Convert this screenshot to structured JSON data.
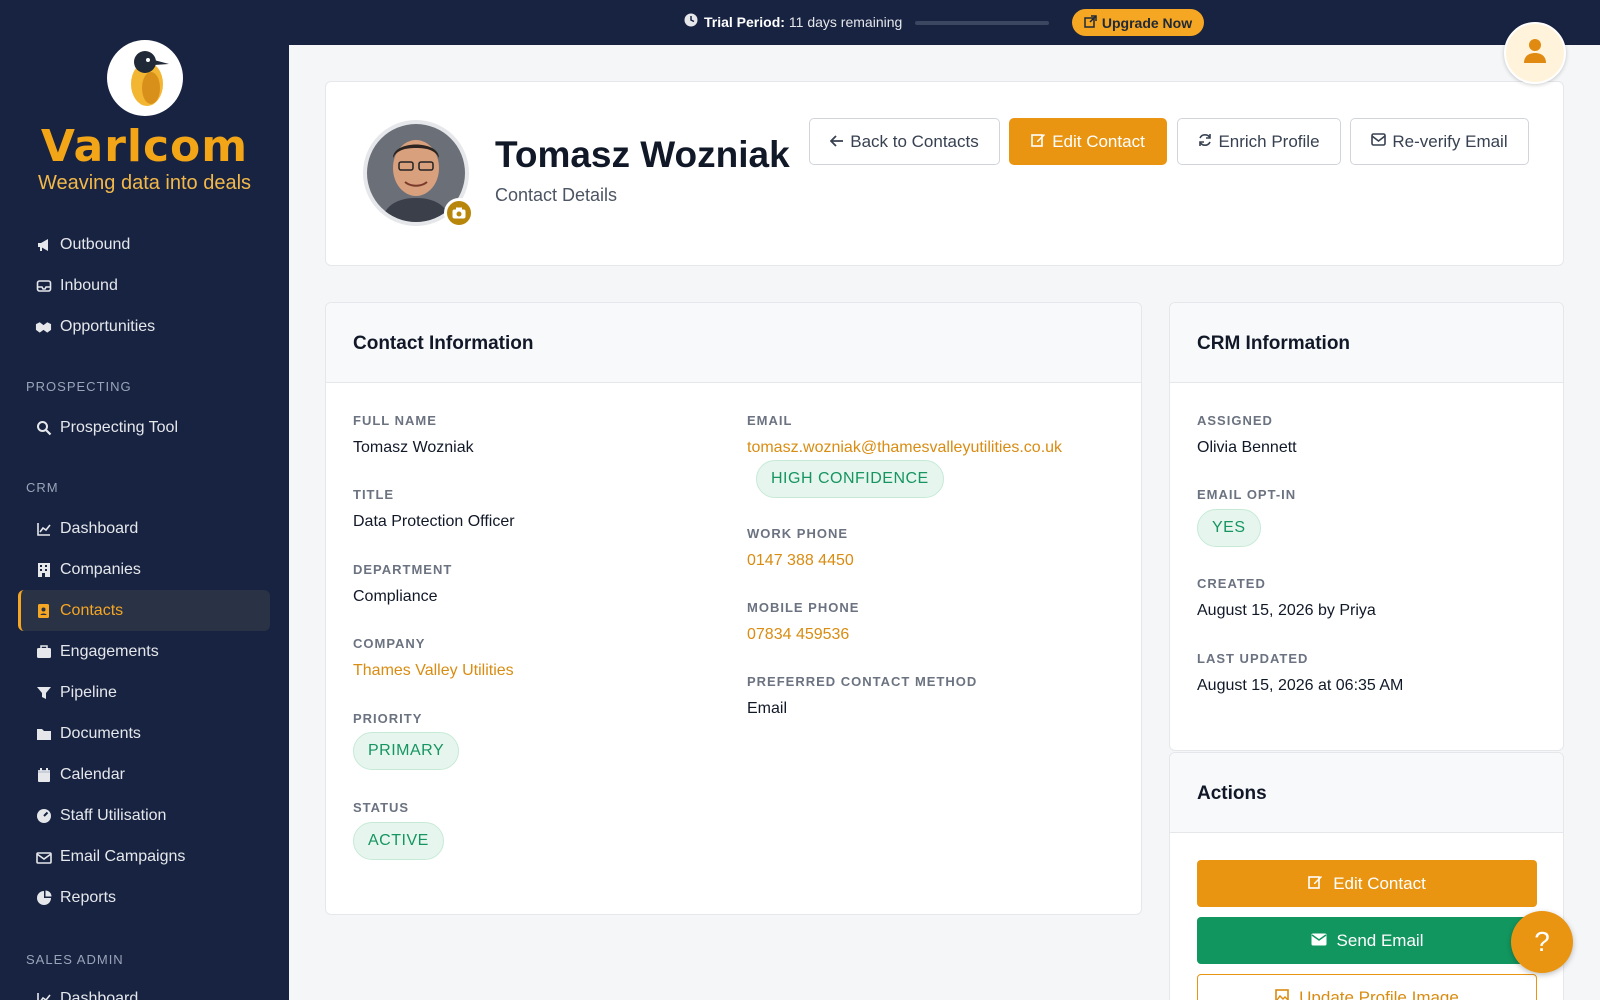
{
  "brand": {
    "name": "Varlcom",
    "tagline": "Weaving data into deals",
    "accent": "#f5a623"
  },
  "topbar": {
    "trial_label": "Trial Period:",
    "trial_remaining": "11 days remaining",
    "trial_progress": 0.0,
    "upgrade_label": "Upgrade Now"
  },
  "sidebar": {
    "top_items": [
      {
        "label": "Outbound",
        "icon": "megaphone-icon"
      },
      {
        "label": "Inbound",
        "icon": "inbox-icon"
      },
      {
        "label": "Opportunities",
        "icon": "handshake-icon"
      }
    ],
    "section_prospecting": "PROSPECTING",
    "prospecting_items": [
      {
        "label": "Prospecting Tool",
        "icon": "search-icon"
      }
    ],
    "section_crm": "CRM",
    "crm_items": [
      {
        "label": "Dashboard",
        "icon": "chart-line-icon"
      },
      {
        "label": "Companies",
        "icon": "building-icon"
      },
      {
        "label": "Contacts",
        "icon": "address-book-icon",
        "active": true
      },
      {
        "label": "Engagements",
        "icon": "briefcase-icon"
      },
      {
        "label": "Pipeline",
        "icon": "funnel-icon"
      },
      {
        "label": "Documents",
        "icon": "folder-icon"
      },
      {
        "label": "Calendar",
        "icon": "calendar-icon"
      },
      {
        "label": "Staff Utilisation",
        "icon": "gauge-icon"
      },
      {
        "label": "Email Campaigns",
        "icon": "mail-bulk-icon"
      },
      {
        "label": "Reports",
        "icon": "pie-chart-icon"
      }
    ],
    "section_sales_admin": "SALES ADMIN",
    "sales_admin_items": [
      {
        "label": "Dashboard",
        "icon": "chart-line-icon"
      }
    ]
  },
  "header": {
    "name": "Tomasz Wozniak",
    "subtitle": "Contact Details",
    "buttons": {
      "back": "Back to Contacts",
      "edit": "Edit Contact",
      "enrich": "Enrich Profile",
      "reverify": "Re-verify Email"
    }
  },
  "contact_info": {
    "title": "Contact Information",
    "full_name_label": "FULL NAME",
    "full_name": "Tomasz Wozniak",
    "title_label": "TITLE",
    "job_title": "Data Protection Officer",
    "department_label": "DEPARTMENT",
    "department": "Compliance",
    "company_label": "COMPANY",
    "company": "Thames Valley Utilities",
    "priority_label": "PRIORITY",
    "priority": "PRIMARY",
    "status_label": "STATUS",
    "status": "ACTIVE",
    "email_label": "EMAIL",
    "email": "tomasz.wozniak@thamesvalleyutilities.co.uk",
    "email_confidence": "HIGH CONFIDENCE",
    "work_phone_label": "WORK PHONE",
    "work_phone": "0147 388 4450",
    "mobile_phone_label": "MOBILE PHONE",
    "mobile_phone": "07834 459536",
    "preferred_label": "PREFERRED CONTACT METHOD",
    "preferred": "Email"
  },
  "crm_info": {
    "title": "CRM Information",
    "assigned_label": "ASSIGNED",
    "assigned": "Olivia Bennett",
    "optin_label": "EMAIL OPT-IN",
    "optin": "YES",
    "created_label": "CREATED",
    "created": "August 15, 2026 by Priya",
    "updated_label": "LAST UPDATED",
    "updated": "August 15, 2026 at 06:35 AM"
  },
  "actions": {
    "title": "Actions",
    "edit": "Edit Contact",
    "send_email": "Send Email",
    "update_image": "Update Profile Image"
  },
  "help": {
    "label": "?"
  }
}
